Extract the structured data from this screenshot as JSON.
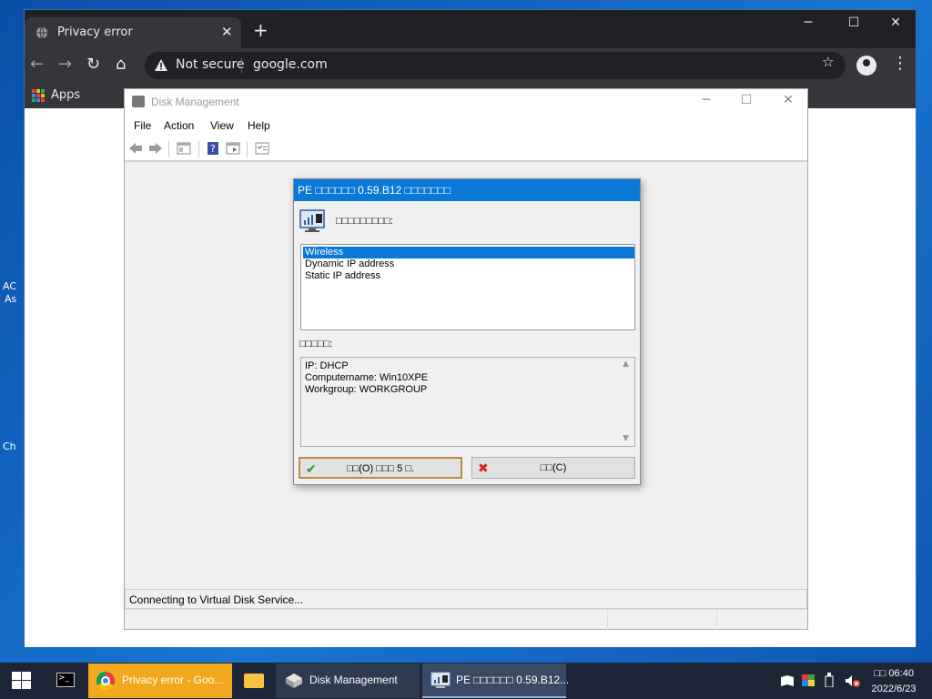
{
  "desktop": {
    "labels": [
      "AC",
      "As",
      "Ch"
    ]
  },
  "chrome": {
    "tab_title": "Privacy error",
    "tab_close": "✕",
    "new_tab": "+",
    "minimize": "─",
    "maximize": "☐",
    "close": "✕",
    "back": "←",
    "forward": "→",
    "reload": "↻",
    "home": "⌂",
    "security_text": "Not secure",
    "url": "google.com",
    "bookmark_star": "☆",
    "menu": "⋮",
    "apps_label": "Apps"
  },
  "disk_management": {
    "title": "Disk Management",
    "minimize": "─",
    "maximize": "☐",
    "close": "✕",
    "menu": [
      "File",
      "Action",
      "View",
      "Help"
    ],
    "status": "Connecting to Virtual Disk Service..."
  },
  "pe_dialog": {
    "title": "PE □□□□□□ 0.59.B12 □□□□□□□",
    "prompt": "□□□□□□□□□:",
    "options": [
      "Wireless",
      "Dynamic IP address",
      "Static IP address"
    ],
    "selected_index": 0,
    "info_label": "□□□□□:",
    "info_lines": [
      "IP: DHCP",
      "Computername: Win10XPE",
      "Workgroup: WORKGROUP"
    ],
    "ok_label": "□□(O) □□□ 5 □.",
    "cancel_label": "□□(C)",
    "ok_glyph": "✔",
    "cancel_glyph": "✖"
  },
  "taskbar": {
    "items": [
      "Privacy error - Goo...",
      "Disk Management",
      "PE □□□□□□ 0.59.B12..."
    ],
    "clock_time": "□□ 06:40",
    "clock_date": "2022/6/23"
  },
  "colors": {
    "accent": "#0a78d7",
    "chrome_bg": "#202124",
    "taskbar_active": "#f3a91f"
  }
}
